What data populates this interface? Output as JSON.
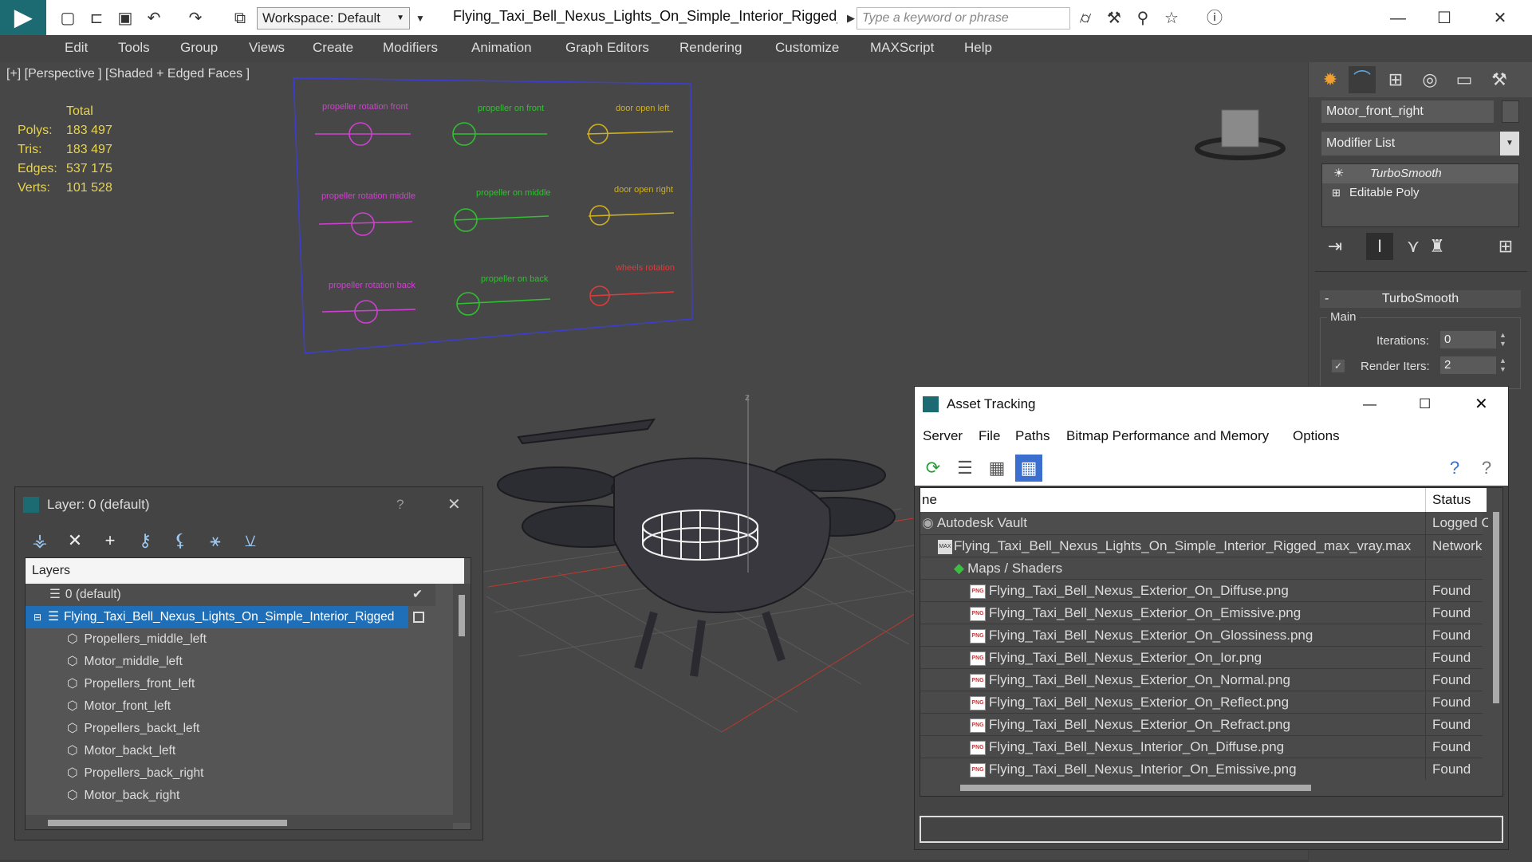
{
  "app": {
    "title": "Flying_Taxi_Bell_Nexus_Lights_On_Simple_Interior_Rigged_...",
    "workspace": "Workspace: Default",
    "search_placeholder": "Type a keyword or phrase"
  },
  "menu": [
    "Edit",
    "Tools",
    "Group",
    "Views",
    "Create",
    "Modifiers",
    "Animation",
    "Graph Editors",
    "Rendering",
    "Customize",
    "MAXScript",
    "Help"
  ],
  "viewport": {
    "label": "[+] [Perspective ] [Shaded + Edged Faces ]",
    "stats": {
      "header": "Total",
      "rows": [
        {
          "label": "Polys:",
          "value": "183 497"
        },
        {
          "label": "Tris:",
          "value": "183 497"
        },
        {
          "label": "Edges:",
          "value": "537 175"
        },
        {
          "label": "Verts:",
          "value": "101 528"
        }
      ]
    },
    "rig_labels": [
      {
        "text": "propeller rotation front",
        "color": "#d040d0"
      },
      {
        "text": "propeller on front",
        "color": "#30c030"
      },
      {
        "text": "door open left",
        "color": "#d0b020"
      },
      {
        "text": "propeller rotation middle",
        "color": "#d040d0"
      },
      {
        "text": "propeller on middle",
        "color": "#30c030"
      },
      {
        "text": "door open right",
        "color": "#d0b020"
      },
      {
        "text": "propeller rotation back",
        "color": "#d040d0"
      },
      {
        "text": "propeller on back",
        "color": "#30c030"
      },
      {
        "text": "wheels rotation",
        "color": "#e03a3a"
      }
    ]
  },
  "command_panel": {
    "object_name": "Motor_front_right",
    "modifier_list": "Modifier List",
    "stack": [
      "TurboSmooth",
      "Editable Poly"
    ],
    "rollout": "TurboSmooth",
    "group": "Main",
    "iterations_label": "Iterations:",
    "iterations": "0",
    "render_iters_label": "Render Iters:",
    "render_iters": "2"
  },
  "layer_window": {
    "title": "Layer: 0 (default)",
    "help": "?",
    "header": "Layers",
    "rows": [
      "0 (default)",
      "Flying_Taxi_Bell_Nexus_Lights_On_Simple_Interior_Rigged",
      "Propellers_middle_left",
      "Motor_middle_left",
      "Propellers_front_left",
      "Motor_front_left",
      "Propellers_backt_left",
      "Motor_backt_left",
      "Propellers_back_right",
      "Motor_back_right"
    ]
  },
  "asset_window": {
    "title": "Asset Tracking",
    "menu": [
      "Server",
      "File",
      "Paths",
      "Bitmap Performance and Memory",
      "Options"
    ],
    "col_name": "ne",
    "col_status": "Status",
    "rows": [
      {
        "name": "Autodesk Vault",
        "status": "Logged C"
      },
      {
        "name": "Flying_Taxi_Bell_Nexus_Lights_On_Simple_Interior_Rigged_max_vray.max",
        "status": "Network"
      },
      {
        "name": "Maps / Shaders",
        "status": ""
      },
      {
        "name": "Flying_Taxi_Bell_Nexus_Exterior_On_Diffuse.png",
        "status": "Found"
      },
      {
        "name": "Flying_Taxi_Bell_Nexus_Exterior_On_Emissive.png",
        "status": "Found"
      },
      {
        "name": "Flying_Taxi_Bell_Nexus_Exterior_On_Glossiness.png",
        "status": "Found"
      },
      {
        "name": "Flying_Taxi_Bell_Nexus_Exterior_On_Ior.png",
        "status": "Found"
      },
      {
        "name": "Flying_Taxi_Bell_Nexus_Exterior_On_Normal.png",
        "status": "Found"
      },
      {
        "name": "Flying_Taxi_Bell_Nexus_Exterior_On_Reflect.png",
        "status": "Found"
      },
      {
        "name": "Flying_Taxi_Bell_Nexus_Exterior_On_Refract.png",
        "status": "Found"
      },
      {
        "name": "Flying_Taxi_Bell_Nexus_Interior_On_Diffuse.png",
        "status": "Found"
      },
      {
        "name": "Flying_Taxi_Bell_Nexus_Interior_On_Emissive.png",
        "status": "Found"
      }
    ]
  }
}
